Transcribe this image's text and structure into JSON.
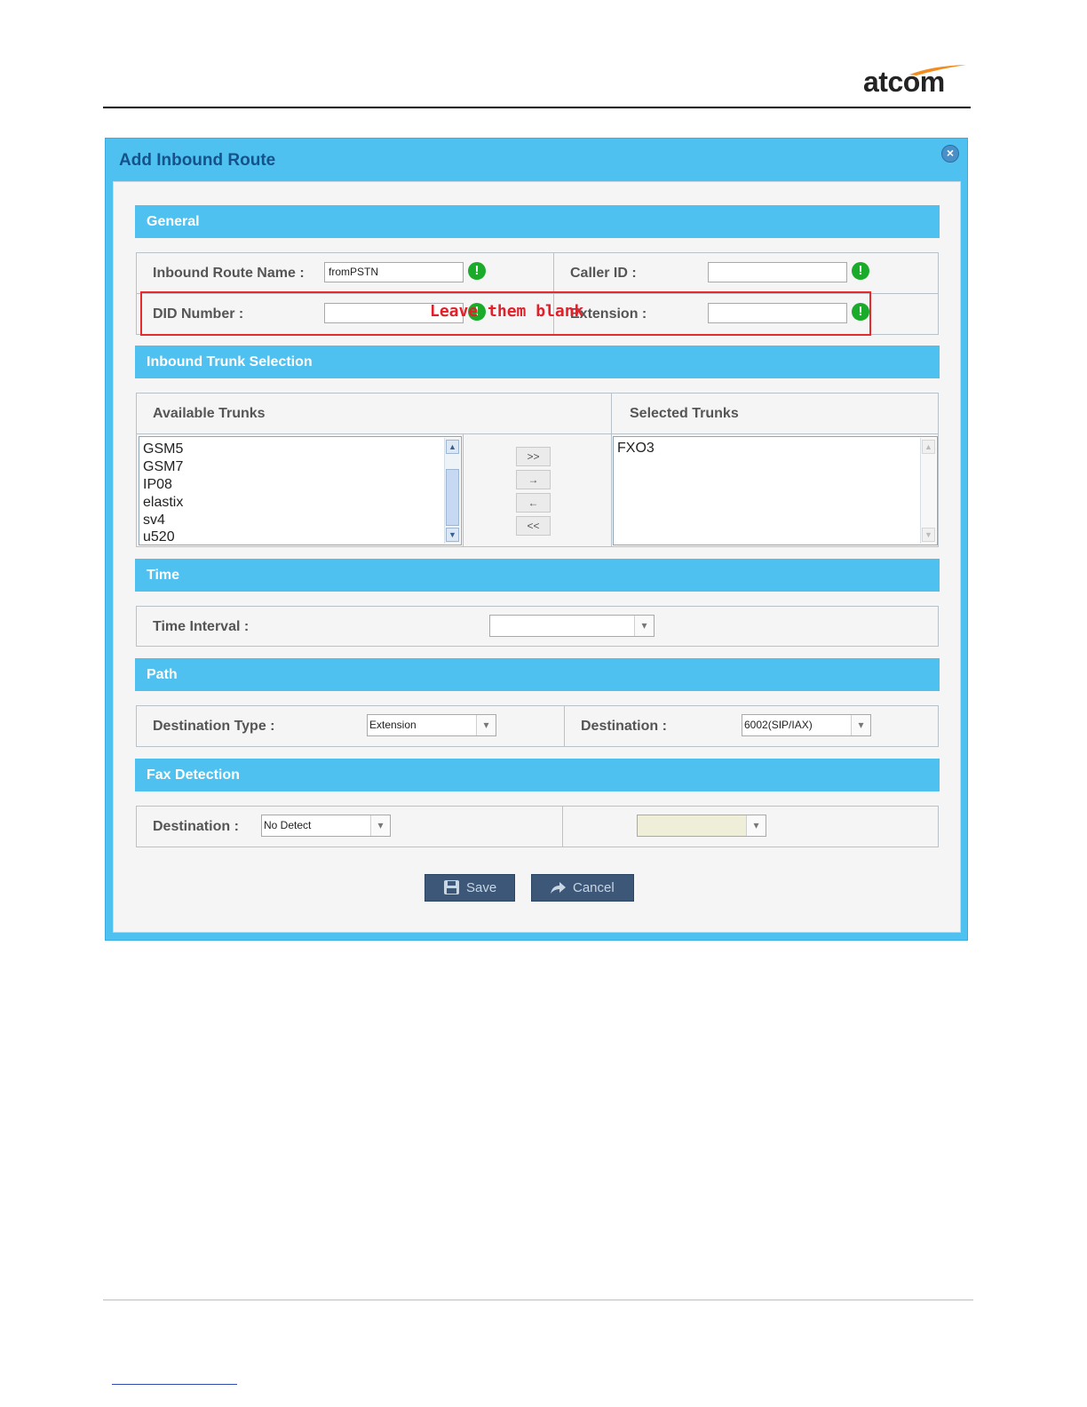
{
  "brand": {
    "logo_text": "atcom"
  },
  "dialog": {
    "title": "Add Inbound Route",
    "close_icon": "close-icon"
  },
  "general": {
    "header": "General",
    "route_name_label": "Inbound Route Name :",
    "route_name_value": "fromPSTN",
    "caller_id_label": "Caller ID :",
    "caller_id_value": "",
    "did_label": "DID Number :",
    "did_value": "",
    "extension_label": "Extension :",
    "extension_value": ""
  },
  "trunks": {
    "header": "Inbound Trunk Selection",
    "available_label": "Available Trunks",
    "selected_label": "Selected Trunks",
    "available": [
      "GSM5",
      "GSM7",
      "IP08",
      "elastix",
      "sv4",
      "u520"
    ],
    "selected": [
      "FXO3"
    ],
    "buttons": [
      ">>",
      "→",
      "←",
      "<<"
    ]
  },
  "time": {
    "header": "Time",
    "interval_label": "Time Interval :",
    "interval_value": ""
  },
  "path": {
    "header": "Path",
    "dest_type_label": "Destination Type :",
    "dest_type_value": "Extension",
    "dest_label": "Destination :",
    "dest_value": "6002(SIP/IAX)"
  },
  "fax": {
    "header": "Fax Detection",
    "dest_label": "Destination :",
    "dest_value": "No Detect",
    "second_value": ""
  },
  "actions": {
    "save_label": "Save",
    "cancel_label": "Cancel"
  },
  "annotation": {
    "text": "Leave them blank",
    "color": "#e52b2b"
  },
  "colors": {
    "accent": "#4ec1f1",
    "title": "#15528a",
    "button": "#3c5778",
    "ok": "#1aab2a"
  }
}
